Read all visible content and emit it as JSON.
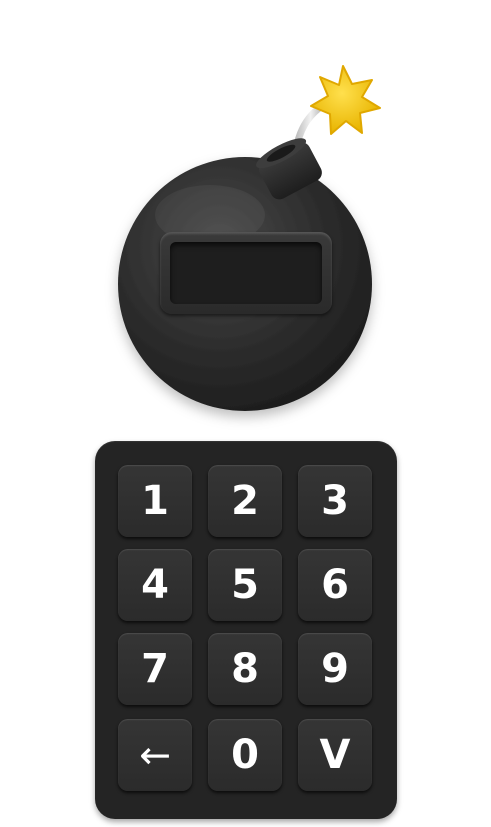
{
  "bomb": {
    "display_value": "",
    "fuse_spark_color": "#f5c518",
    "body_color": "#2c2c2c"
  },
  "keypad": {
    "keys": [
      {
        "label": "1",
        "action": "digit"
      },
      {
        "label": "2",
        "action": "digit"
      },
      {
        "label": "3",
        "action": "digit"
      },
      {
        "label": "4",
        "action": "digit"
      },
      {
        "label": "5",
        "action": "digit"
      },
      {
        "label": "6",
        "action": "digit"
      },
      {
        "label": "7",
        "action": "digit"
      },
      {
        "label": "8",
        "action": "digit"
      },
      {
        "label": "9",
        "action": "digit"
      },
      {
        "label": "←",
        "action": "backspace",
        "icon": "left-arrow-icon"
      },
      {
        "label": "0",
        "action": "digit"
      },
      {
        "label": "V",
        "action": "submit"
      }
    ]
  }
}
